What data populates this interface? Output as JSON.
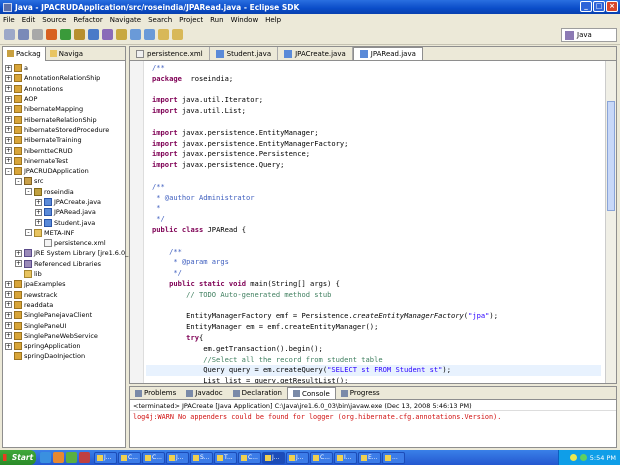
{
  "window": {
    "title": "Java - JPACRUDApplication/src/roseindia/JPARead.java - Eclipse SDK"
  },
  "menu": [
    "File",
    "Edit",
    "Source",
    "Refactor",
    "Navigate",
    "Search",
    "Project",
    "Run",
    "Window",
    "Help"
  ],
  "perspective": {
    "label": "Java"
  },
  "left_pane": {
    "tabs": [
      {
        "label": "Packag"
      },
      {
        "label": "Naviga"
      }
    ],
    "tree": [
      {
        "level": 0,
        "expander": "+",
        "icon": "proj",
        "label": "a"
      },
      {
        "level": 0,
        "expander": "+",
        "icon": "proj",
        "label": "AnnotationRelationShip"
      },
      {
        "level": 0,
        "expander": "+",
        "icon": "proj",
        "label": "Annotations"
      },
      {
        "level": 0,
        "expander": "+",
        "icon": "proj",
        "label": "AOP"
      },
      {
        "level": 0,
        "expander": "+",
        "icon": "proj",
        "label": "hibernateMapping"
      },
      {
        "level": 0,
        "expander": "+",
        "icon": "proj",
        "label": "HibernateRelationShip"
      },
      {
        "level": 0,
        "expander": "+",
        "icon": "proj",
        "label": "hibernateStoredProcedure"
      },
      {
        "level": 0,
        "expander": "+",
        "icon": "proj",
        "label": "HibernateTraining"
      },
      {
        "level": 0,
        "expander": "+",
        "icon": "proj",
        "label": "hiberntteCRUD"
      },
      {
        "level": 0,
        "expander": "+",
        "icon": "proj",
        "label": "hinernateTest"
      },
      {
        "level": 0,
        "expander": "-",
        "icon": "proj",
        "label": "JPACRUDApplication"
      },
      {
        "level": 1,
        "expander": "-",
        "icon": "src",
        "label": "src"
      },
      {
        "level": 2,
        "expander": "-",
        "icon": "pkg",
        "label": "roseindia"
      },
      {
        "level": 3,
        "expander": "+",
        "icon": "java",
        "label": "JPACreate.java"
      },
      {
        "level": 3,
        "expander": "+",
        "icon": "java",
        "label": "JPARead.java"
      },
      {
        "level": 3,
        "expander": "+",
        "icon": "java",
        "label": "Student.java"
      },
      {
        "level": 2,
        "expander": "-",
        "icon": "folder",
        "label": "META-INF"
      },
      {
        "level": 3,
        "expander": "",
        "icon": "xml",
        "label": "persistence.xml"
      },
      {
        "level": 1,
        "expander": "+",
        "icon": "lib",
        "label": "JRE System Library [jre1.6.0_"
      },
      {
        "level": 1,
        "expander": "+",
        "icon": "lib",
        "label": "Referenced Libraries"
      },
      {
        "level": 1,
        "expander": "",
        "icon": "folder",
        "label": "lib"
      },
      {
        "level": 0,
        "expander": "+",
        "icon": "proj",
        "label": "jpaExamples"
      },
      {
        "level": 0,
        "expander": "+",
        "icon": "proj",
        "label": "newstrack"
      },
      {
        "level": 0,
        "expander": "+",
        "icon": "proj",
        "label": "readdata"
      },
      {
        "level": 0,
        "expander": "+",
        "icon": "proj",
        "label": "SinglePanejavaClient"
      },
      {
        "level": 0,
        "expander": "+",
        "icon": "proj",
        "label": "SinglePaneUI"
      },
      {
        "level": 0,
        "expander": "+",
        "icon": "proj",
        "label": "SinglePaneWebService"
      },
      {
        "level": 0,
        "expander": "+",
        "icon": "proj",
        "label": "springApplication"
      },
      {
        "level": 0,
        "expander": "",
        "icon": "proj",
        "label": "springDaoInjection"
      }
    ]
  },
  "editor": {
    "tabs": [
      {
        "label": "persistence.xml",
        "icon": "x",
        "active": false
      },
      {
        "label": "Student.java",
        "icon": "j",
        "active": false
      },
      {
        "label": "JPACreate.java",
        "icon": "j",
        "active": false
      },
      {
        "label": "JPARead.java",
        "icon": "j",
        "active": true
      }
    ],
    "lines": [
      [
        [
          "jd",
          "/**"
        ]
      ],
      [
        [
          "kw",
          "package"
        ],
        [
          "",
          "  roseindia;"
        ]
      ],
      [],
      [
        [
          "kw",
          "import"
        ],
        [
          "",
          " java.util.Iterator;"
        ]
      ],
      [
        [
          "kw",
          "import"
        ],
        [
          "",
          " java.util.List;"
        ]
      ],
      [],
      [
        [
          "kw",
          "import"
        ],
        [
          "",
          " javax.persistence.EntityManager;"
        ]
      ],
      [
        [
          "kw",
          "import"
        ],
        [
          "",
          " javax.persistence.EntityManagerFactory;"
        ]
      ],
      [
        [
          "kw",
          "import"
        ],
        [
          "",
          " javax.persistence.Persistence;"
        ]
      ],
      [
        [
          "kw",
          "import"
        ],
        [
          "",
          " javax.persistence.Query;"
        ]
      ],
      [],
      [
        [
          "jd",
          "/**"
        ]
      ],
      [
        [
          "jd",
          " * @author Administrator"
        ]
      ],
      [
        [
          "jd",
          " *"
        ]
      ],
      [
        [
          "jd",
          " */"
        ]
      ],
      [
        [
          "kw",
          "public"
        ],
        [
          "",
          " "
        ],
        [
          "kw",
          "class"
        ],
        [
          "",
          " JPARead {"
        ]
      ],
      [],
      [
        [
          "jd",
          "    /**"
        ]
      ],
      [
        [
          "jd",
          "     * @param args"
        ]
      ],
      [
        [
          "jd",
          "     */"
        ]
      ],
      [
        [
          "",
          "    "
        ],
        [
          "kw",
          "public"
        ],
        [
          "",
          " "
        ],
        [
          "kw",
          "static"
        ],
        [
          "",
          " "
        ],
        [
          "kw",
          "void"
        ],
        [
          "",
          " main(String[] args) {"
        ]
      ],
      [
        [
          "cm",
          "        // TODO Auto-generated method stub"
        ]
      ],
      [],
      [
        [
          "",
          "        EntityManagerFactory emf = Persistence."
        ],
        [
          "it",
          "createEntityManagerFactory"
        ],
        [
          "",
          "("
        ],
        [
          "str",
          "\"jpa\""
        ],
        [
          "",
          ");"
        ]
      ],
      [
        [
          "",
          "        EntityManager em = emf.createEntityManager();"
        ]
      ],
      [
        [
          "",
          "        "
        ],
        [
          "kw",
          "try"
        ],
        [
          "",
          "{"
        ]
      ],
      [
        [
          "",
          "            em.getTransaction().begin();"
        ]
      ],
      [
        [
          "cm",
          "            //Select all the record from student table"
        ]
      ],
      [
        [
          "",
          "            Query query = em.createQuery("
        ],
        [
          "str",
          "\"SELECT st FROM Student st\""
        ],
        [
          "",
          ");"
        ]
      ],
      [
        [
          "",
          "            List list = query.getResultList();"
        ]
      ]
    ]
  },
  "bottom": {
    "tabs": [
      {
        "label": "Problems"
      },
      {
        "label": "Javadoc"
      },
      {
        "label": "Declaration"
      },
      {
        "label": "Console"
      },
      {
        "label": "Progress"
      }
    ],
    "active_tab": "Console",
    "console_header": "<terminated> JPACreate [Java Application] C:\\Java\\jre1.6.0_03\\bin\\javaw.exe (Dec 13, 2008 5:46:13 PM)",
    "console_line": "log4j:WARN No appenders could be found for logger (org.hibernate.cfg.annotations.Version)."
  },
  "taskbar": {
    "start_label": "Start",
    "tasks": [
      "J...",
      "C...",
      "C...",
      "J...",
      "S...",
      "T...",
      "C...",
      "J...",
      "J...",
      "C...",
      "I...",
      "E...",
      "..."
    ],
    "clock": "5:54 PM"
  }
}
